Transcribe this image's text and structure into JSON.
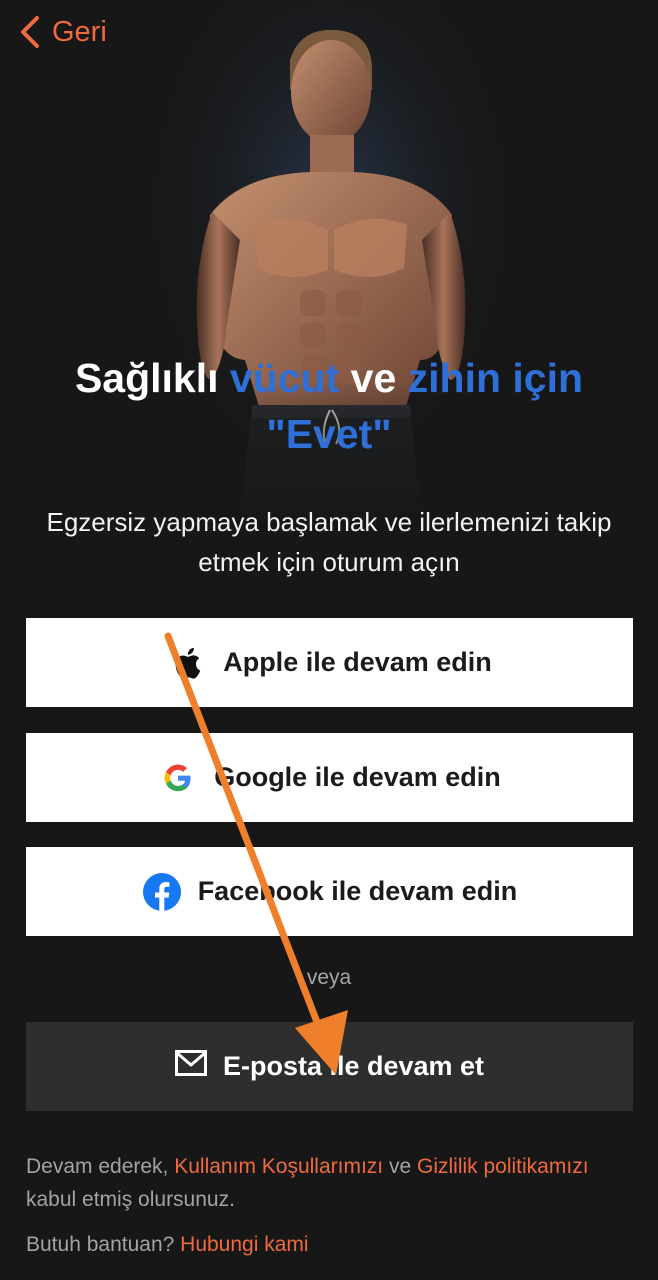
{
  "nav": {
    "back_label": "Geri"
  },
  "hero": {
    "headline_part1": "Sağlıklı ",
    "headline_part2": "vücut",
    "headline_part3": " ve ",
    "headline_part4": "zihin için",
    "headline_part5": "\"Evet\""
  },
  "subtitle": "Egzersiz yapmaya başlamak ve ilerlemenizi takip etmek için oturum açın",
  "buttons": {
    "apple": "Apple ile devam edin",
    "google": "Google ile devam edin",
    "facebook": "Facebook ile devam edin",
    "or": "veya",
    "email": "E-posta ile devam et"
  },
  "legal": {
    "prefix": "Devam ederek, ",
    "terms_link": "Kullanım Koşullarımızı",
    "middle": " ve ",
    "privacy_link": "Gizlilik politikamızı",
    "suffix": " kabul etmiş olursunuz."
  },
  "help": {
    "question": "Butuh bantuan?",
    "link": "Hubungi kami"
  },
  "colors": {
    "background": "#171717",
    "accent_orange": "#ef6a3c",
    "headline_blue": "#2e6fd8",
    "annotation_arrow": "#f07f2c"
  },
  "icons": {
    "back": "chevron-left-icon",
    "apple": "apple-logo-icon",
    "google": "google-logo-icon",
    "facebook": "facebook-logo-icon",
    "email": "envelope-icon",
    "annotation": "arrow-annotation"
  }
}
